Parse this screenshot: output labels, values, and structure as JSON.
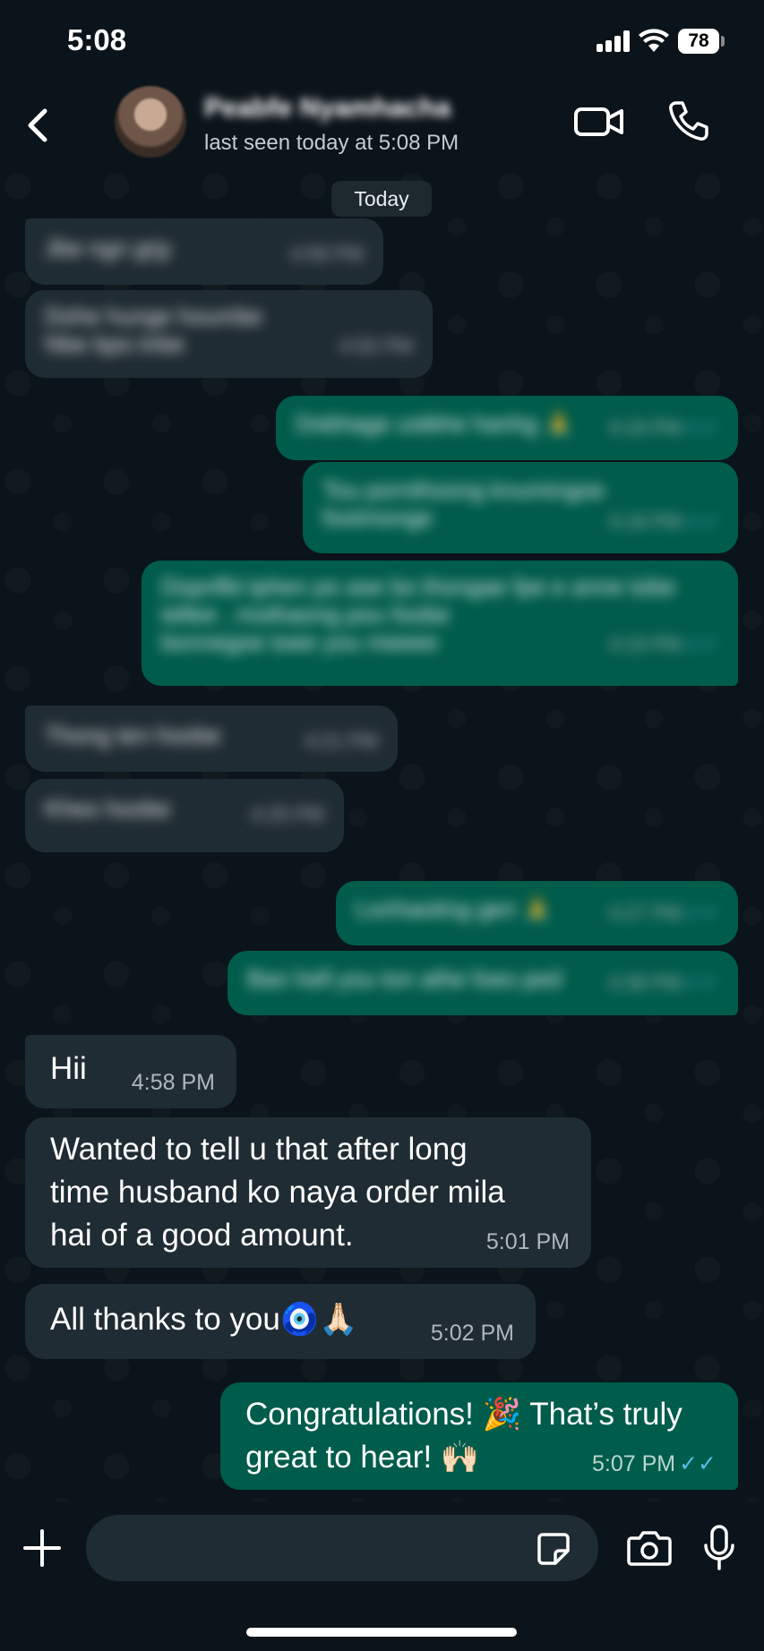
{
  "status_bar": {
    "time": "5:08",
    "battery": "78"
  },
  "header": {
    "contact_name": "Peabfe Nyamhacha",
    "last_seen": "last seen today at 5:08 PM"
  },
  "chat": {
    "date_chip": "Today",
    "blurred_messages": [
      {
        "dir": "in",
        "lines": [
          "Jbe ngn grjy"
        ],
        "time": "4:58 PM"
      },
      {
        "dir": "in",
        "lines": [
          "Dohe hunge houmbe",
          "Nbe bpo tnbe"
        ],
        "time": "4:55 PM"
      },
      {
        "dir": "out",
        "lines": [
          "Dobhage ustbhe hanhg 🙏"
        ],
        "time": "4:18 PM"
      },
      {
        "dir": "out",
        "lines": [
          "Tou pornthoong knumingoe",
          "footmonge"
        ],
        "time": "4:18 PM"
      },
      {
        "dir": "out",
        "lines": [
          "Dopnfbt tphen po ase bo thongae fpe e anne tobe",
          "tellee , mothaong pou foobe",
          "bonnegoe toee you meeee"
        ],
        "time": "4:19 PM"
      },
      {
        "dir": "in",
        "lines": [
          "Thong ten hoobe"
        ],
        "time": "4:21 PM"
      },
      {
        "dir": "in",
        "lines": [
          "Kheo hoobe"
        ],
        "time": "4:25 PM"
      },
      {
        "dir": "out",
        "lines": [
          "Lonhaoting gen 🙏"
        ],
        "time": "4:27 PM"
      },
      {
        "dir": "out",
        "lines": [
          "Ban hell you ton athe foes ped"
        ],
        "time": "4:38 PM"
      }
    ],
    "messages": [
      {
        "dir": "in",
        "text": "Hii",
        "time": "4:58 PM"
      },
      {
        "dir": "in",
        "text": "Wanted to tell u that after long\ntime husband ko naya order mila\nhai of a good amount.",
        "time": "5:01 PM"
      },
      {
        "dir": "in",
        "text": "All thanks to you🧿🙏🏻",
        "time": "5:02 PM"
      },
      {
        "dir": "out",
        "text": "Congratulations! 🎉 That’s truly\ngreat to hear! 🙌🏻",
        "time": "5:07 PM"
      }
    ],
    "tick_glyph": "✓✓"
  },
  "input": {
    "placeholder": ""
  },
  "icons": [
    "back-chevron-icon",
    "video-call-icon",
    "phone-icon",
    "plus-icon",
    "sticker-icon",
    "camera-icon",
    "mic-icon"
  ],
  "colors": {
    "background": "#0b141a",
    "incoming": "#202c33",
    "outgoing": "#005c4b",
    "read_ticks": "#53bdeb"
  }
}
